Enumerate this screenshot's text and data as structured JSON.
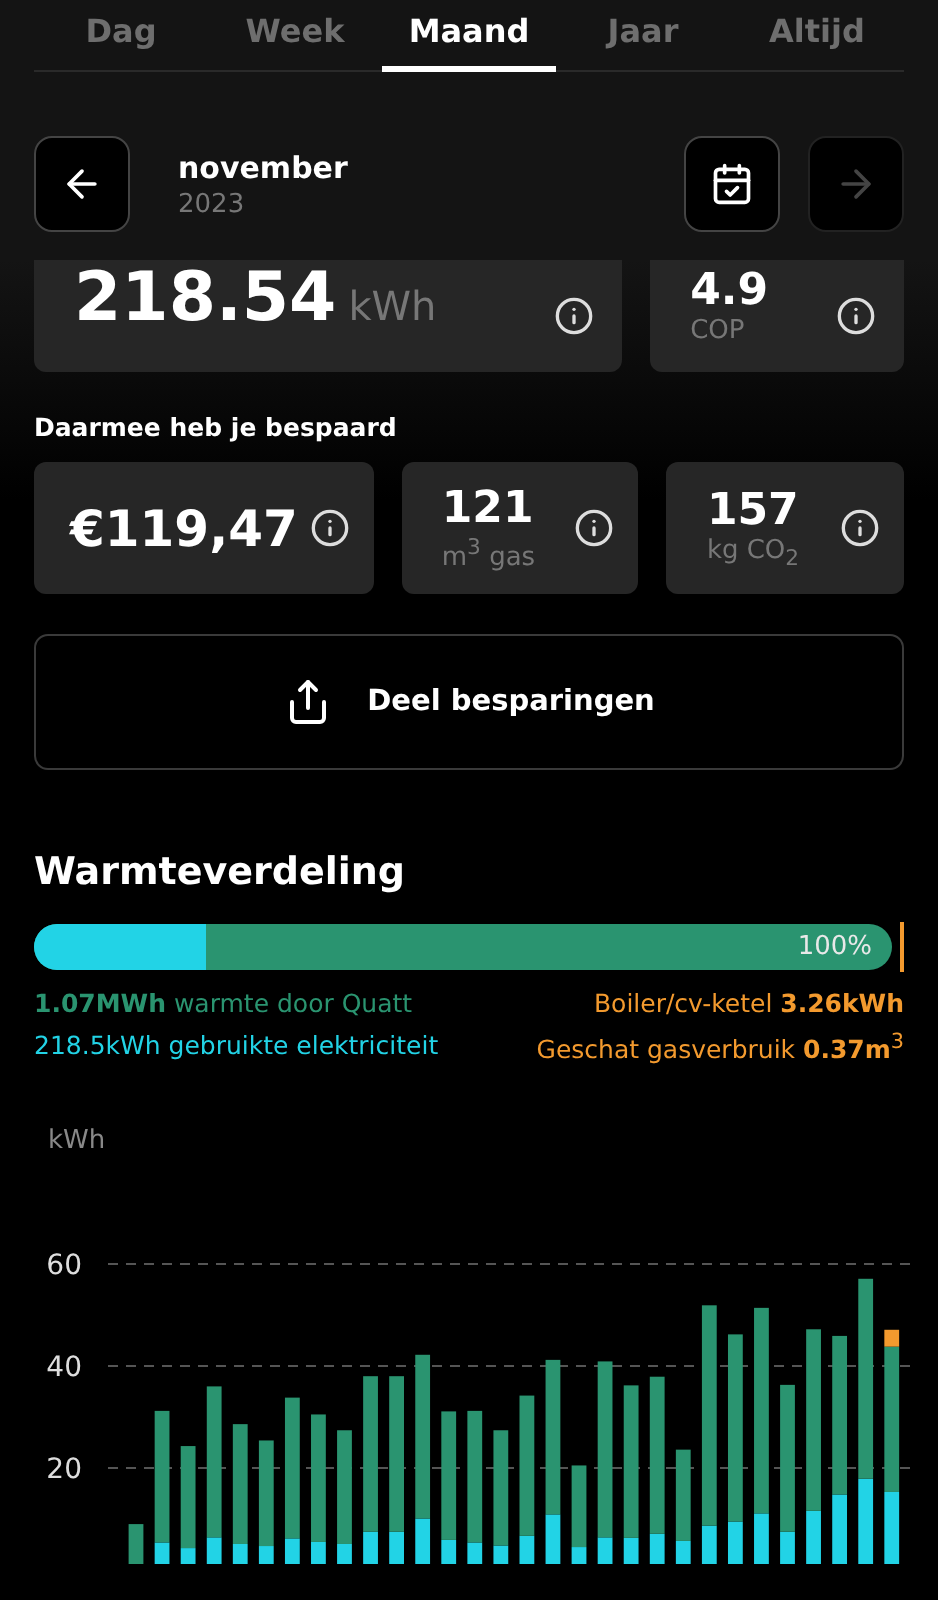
{
  "tabs": [
    {
      "label": "Dag",
      "selected": false
    },
    {
      "label": "Week",
      "selected": false
    },
    {
      "label": "Maand",
      "selected": true
    },
    {
      "label": "Jaar",
      "selected": false
    },
    {
      "label": "Altijd",
      "selected": false
    }
  ],
  "period": {
    "month": "november",
    "year": "2023",
    "previous_disabled": false,
    "next_disabled": true
  },
  "stats": [
    {
      "kind": "inline",
      "value": "218.54",
      "unit": "kWh"
    },
    {
      "kind": "stacked",
      "value": "4.9",
      "unit": "COP"
    }
  ],
  "savings": {
    "title": "Daarmee heb je bespaard",
    "cards": [
      {
        "kind": "large",
        "value": "€119,47"
      },
      {
        "kind": "stacked",
        "value": "121",
        "unit": "m$^{3}$ gas"
      },
      {
        "kind": "stacked",
        "value": "157",
        "unit": "kg CO$_{2}$"
      }
    ]
  },
  "share_button": "Deel besparingen",
  "distribution": {
    "title": "Warmteverdeling",
    "level": 0.2,
    "percent": "100%",
    "legend": [
      {
        "text": "**1.07MWh** warmte door Quatt",
        "color": "#2a9470"
      },
      {
        "text": "Boiler/cv-ketel **3.26kWh**",
        "color": "#f39a2e"
      },
      {
        "text": "218.5kWh gebruikte elektriciteit",
        "color": "#22d3e6"
      },
      {
        "text": "Geschat gasverbruik **0.37m**$^{3}$",
        "color": "#f39a2e"
      }
    ]
  },
  "chart": {
    "chart_data": {
      "type": "bar",
      "ylabel": "kWh",
      "stacked": true,
      "ylim": [
        0,
        60
      ],
      "yticks": [
        20,
        40,
        60
      ],
      "series": [
        {
          "color": "#22d3e6",
          "values": [
            0,
            5.4,
            4.3,
            6.4,
            5.1,
            4.7,
            6.2,
            5.5,
            5.1,
            7.5,
            7.5,
            10.1,
            5.9,
            5.4,
            4.8,
            6.7,
            10.9,
            4.5,
            6.4,
            6.3,
            7.1,
            5.7,
            8.7,
            9.5,
            11.1,
            7.5,
            11.6,
            14.8,
            17.9,
            15.3
          ]
        },
        {
          "color": "#2a9470",
          "values": [
            9,
            25.8,
            20,
            29.6,
            23.5,
            20.7,
            27.6,
            25,
            22.3,
            30.5,
            30.5,
            32.1,
            25.2,
            25.8,
            22.6,
            27.5,
            30.3,
            16,
            34.5,
            29.9,
            30.8,
            17.9,
            43.2,
            36.7,
            40.3,
            28.8,
            35.6,
            31.1,
            39.2,
            28.5
          ]
        },
        {
          "color": "#f39a2e",
          "values": [
            null,
            null,
            null,
            null,
            null,
            null,
            null,
            null,
            null,
            null,
            null,
            null,
            null,
            null,
            null,
            null,
            null,
            null,
            null,
            null,
            null,
            null,
            null,
            null,
            null,
            null,
            null,
            null,
            null,
            3.3
          ]
        }
      ]
    }
  }
}
